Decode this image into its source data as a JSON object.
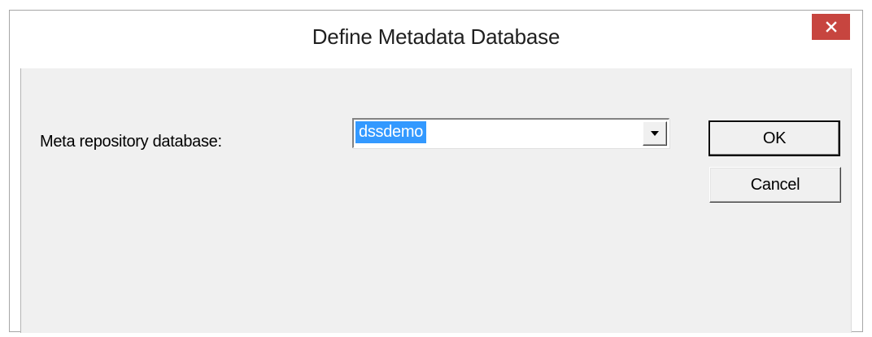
{
  "window": {
    "title": "Define Metadata Database",
    "close_icon": "close-icon"
  },
  "form": {
    "meta_label": "Meta repository database:",
    "database_value": "dssdemo",
    "dropdown_icon": "chevron-down-icon"
  },
  "buttons": {
    "ok_label": "OK",
    "cancel_label": "Cancel"
  },
  "colors": {
    "close_button": "#c7453f",
    "selection": "#3399ff",
    "dialog_body": "#f0f0f0"
  }
}
